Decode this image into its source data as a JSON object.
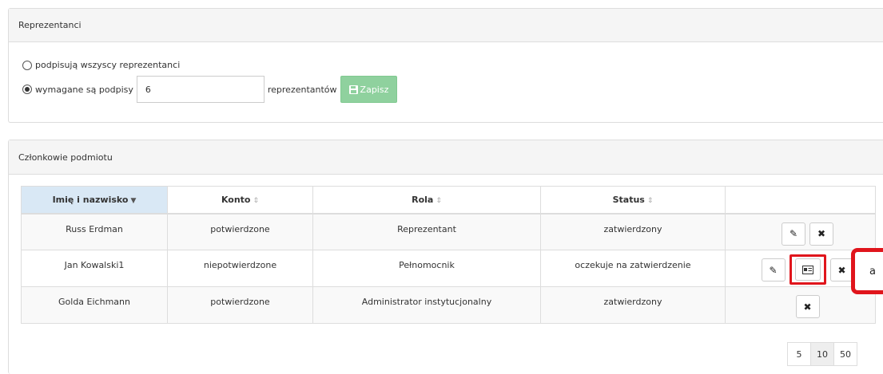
{
  "representatives": {
    "title": "Reprezentanci",
    "option_all": "podpisują wszyscy reprezentanci",
    "option_required": "wymagane są podpisy",
    "required_count": "6",
    "suffix": "reprezentantów",
    "save_label": "Zapisz"
  },
  "members": {
    "title": "Członkowie podmiotu",
    "columns": [
      "Imię i nazwisko",
      "Konto",
      "Rola",
      "Status"
    ],
    "sort_active": "▼",
    "sort_neutral": "⇕",
    "rows": [
      {
        "name": "Russ Erdman",
        "account": "potwierdzone",
        "role": "Reprezentant",
        "status": "zatwierdzony"
      },
      {
        "name": "Jan Kowalski1",
        "account": "niepotwierdzone",
        "role": "Pełnomocnik",
        "status": "oczekuje na zatwierdzenie"
      },
      {
        "name": "Golda Eichmann",
        "account": "potwierdzone",
        "role": "Administrator instytucjonalny",
        "status": "zatwierdzony"
      }
    ]
  },
  "callout_label": "a",
  "pagination": [
    "5",
    "10",
    "50"
  ],
  "colors": {
    "save_button": "#8fd19e",
    "highlight": "#e0151c",
    "sorted_header": "#d9e8f5"
  },
  "icons": {
    "edit": "pencil-icon",
    "delete": "close-icon",
    "details": "id-card-icon",
    "save": "floppy-disk-icon"
  }
}
